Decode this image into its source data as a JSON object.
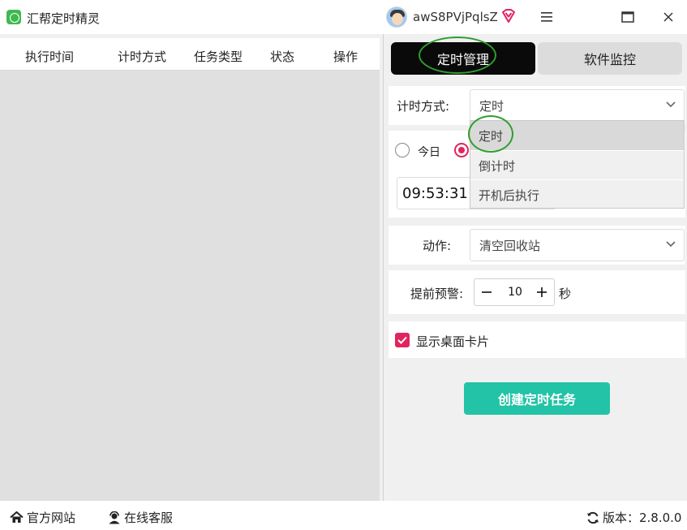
{
  "app": {
    "title": "汇帮定时精灵"
  },
  "user": {
    "name": "awS8PVjPqlsZ"
  },
  "table": {
    "headers": [
      "执行时间",
      "计时方式",
      "任务类型",
      "状态",
      "操作"
    ]
  },
  "tabs": [
    {
      "label": "定时管理",
      "active": true
    },
    {
      "label": "软件监控",
      "active": false
    }
  ],
  "timer": {
    "label": "计时方式:",
    "selected": "定时",
    "options": [
      "定时",
      "倒计时",
      "开机后执行"
    ]
  },
  "day": {
    "today_label": "今日",
    "today_selected": false,
    "other_selected": true
  },
  "time": {
    "value": "09:53:31"
  },
  "action": {
    "label": "动作:",
    "value": "清空回收站"
  },
  "warning": {
    "label": "提前预警:",
    "value": "10",
    "unit": "秒"
  },
  "desktop_card": {
    "label": "显示桌面卡片",
    "checked": true
  },
  "create_button": {
    "label": "创建定时任务"
  },
  "footer": {
    "website": "官方网站",
    "support": "在线客服",
    "version": "版本：2.8.0.0"
  },
  "colors": {
    "accent": "#e0245e",
    "primary": "#22c3a6",
    "tab_active": "#0a0a0a",
    "highlight": "#2f9e2f"
  }
}
